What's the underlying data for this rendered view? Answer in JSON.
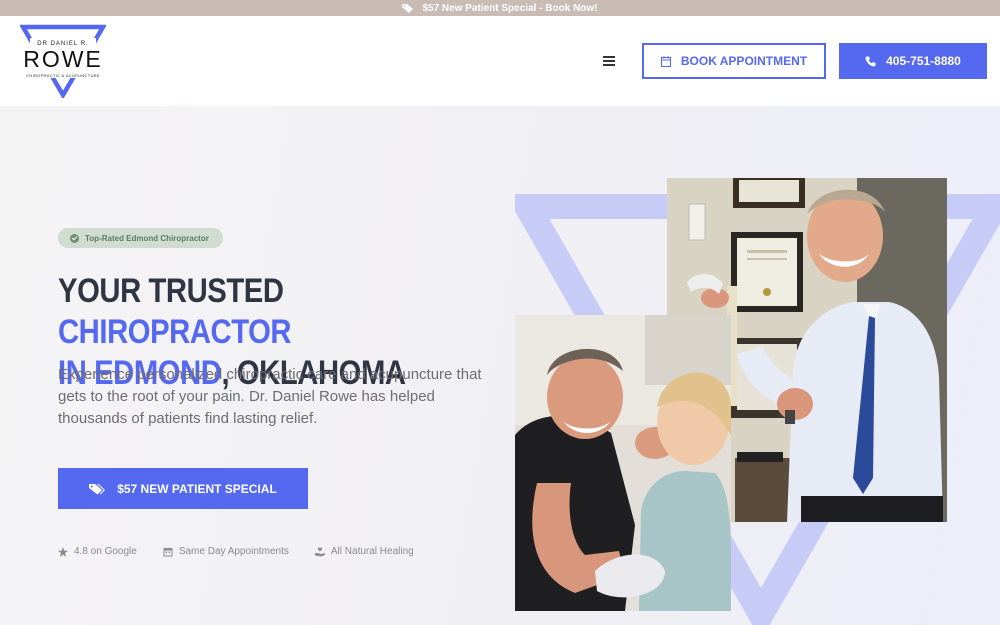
{
  "promo": {
    "text": "$57 New Patient Special - Book Now!",
    "icon": "tag-icon"
  },
  "logo": {
    "line1": "DR DANIEL R.",
    "line2": "ROWE",
    "line3": "CHIROPRACTIC & ACUPUNCTURE"
  },
  "header": {
    "menu_icon": "hamburger-icon",
    "book_label": "BOOK APPOINTMENT",
    "phone_label": "405-751-8880"
  },
  "hero": {
    "badge": "Top-Rated Edmond Chiropractor",
    "headline": {
      "part1": "YOUR TRUSTED ",
      "accent1": "CHIROPRACTOR",
      "accent2": "IN EDMOND",
      "part2": ", OKLAHOMA"
    },
    "subtext": "Experience personalized chiropractic care and acupuncture that gets to the root of your pain. Dr. Daniel Rowe has helped thousands of patients find lasting relief.",
    "cta_label": "$57 NEW PATIENT SPECIAL",
    "features": [
      {
        "icon": "star-icon",
        "label": "4.8 on Google"
      },
      {
        "icon": "calendar-icon",
        "label": "Same Day Appointments"
      },
      {
        "icon": "hand-heart-icon",
        "label": "All Natural Healing"
      }
    ]
  },
  "colors": {
    "accent": "#5468f0",
    "promo_bg": "#c9bcb5",
    "badge_bg": "#cfdccf",
    "heading": "#2f3542"
  }
}
